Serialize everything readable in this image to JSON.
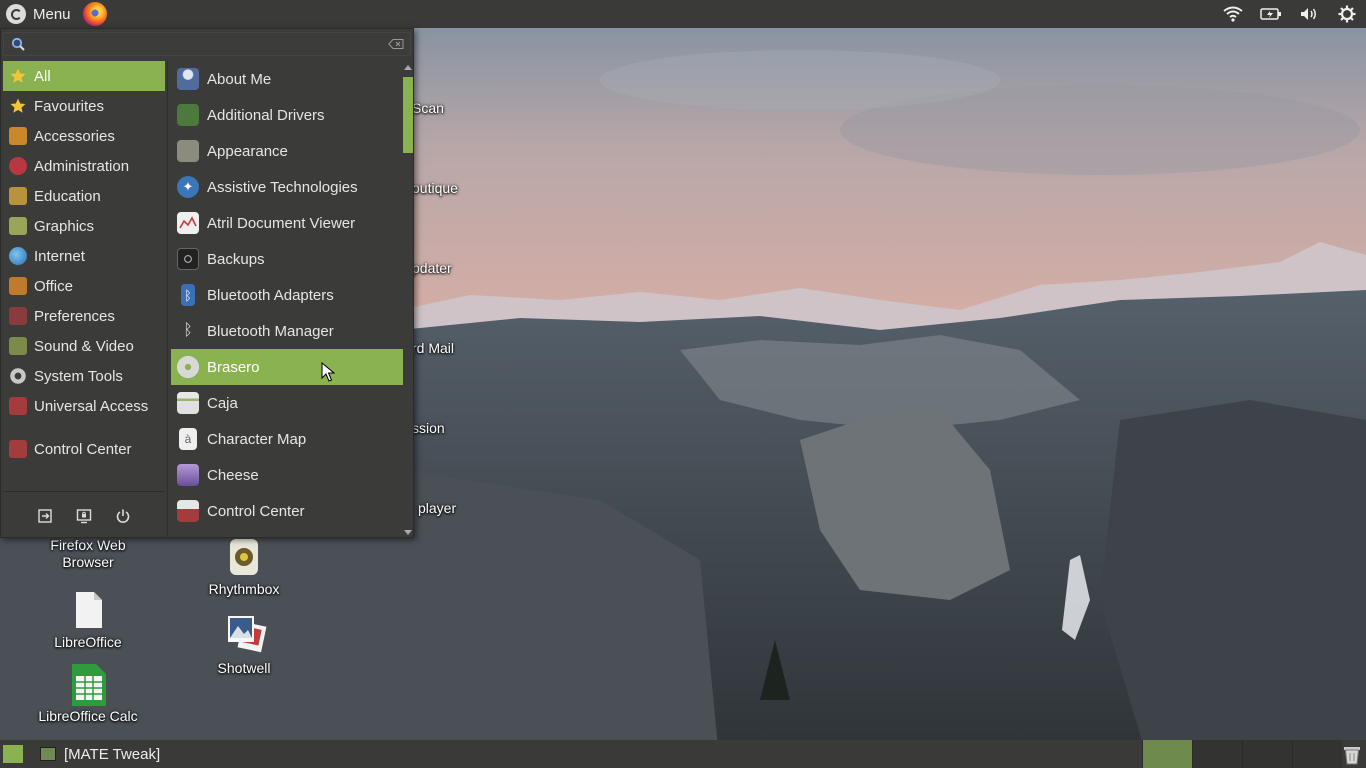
{
  "top_panel": {
    "menu_label": "Menu",
    "launcher_icon": "firefox-icon",
    "tray_icons": [
      "wifi-icon",
      "battery-icon",
      "volume-icon",
      "settings-gear-icon"
    ]
  },
  "menu": {
    "search": {
      "value": "",
      "placeholder": ""
    },
    "categories": [
      {
        "label": "All",
        "icon": "all-star-icon",
        "active": true
      },
      {
        "label": "Favourites",
        "icon": "favourites-star-icon"
      },
      {
        "label": "Accessories",
        "icon": "accessories-icon"
      },
      {
        "label": "Administration",
        "icon": "administration-icon"
      },
      {
        "label": "Education",
        "icon": "education-icon"
      },
      {
        "label": "Graphics",
        "icon": "graphics-icon"
      },
      {
        "label": "Internet",
        "icon": "internet-globe-icon"
      },
      {
        "label": "Office",
        "icon": "office-icon"
      },
      {
        "label": "Preferences",
        "icon": "preferences-icon"
      },
      {
        "label": "Sound & Video",
        "icon": "sound-video-icon"
      },
      {
        "label": "System Tools",
        "icon": "system-tools-gear-icon"
      },
      {
        "label": "Universal Access",
        "icon": "universal-access-icon"
      }
    ],
    "control_center_label": "Control Center",
    "bottom_buttons": [
      "logout-icon",
      "lock-screen-icon",
      "power-icon"
    ],
    "applications": [
      {
        "label": "About Me",
        "icon": "about-me-icon"
      },
      {
        "label": "Additional Drivers",
        "icon": "additional-drivers-icon"
      },
      {
        "label": "Appearance",
        "icon": "appearance-icon"
      },
      {
        "label": "Assistive Technologies",
        "icon": "assistive-technologies-icon"
      },
      {
        "label": "Atril Document Viewer",
        "icon": "atril-icon"
      },
      {
        "label": "Backups",
        "icon": "backups-icon"
      },
      {
        "label": "Bluetooth Adapters",
        "icon": "bluetooth-adapters-icon"
      },
      {
        "label": "Bluetooth Manager",
        "icon": "bluetooth-icon"
      },
      {
        "label": "Brasero",
        "icon": "brasero-disc-icon",
        "hovered": true
      },
      {
        "label": "Caja",
        "icon": "caja-icon"
      },
      {
        "label": "Character Map",
        "icon": "character-map-icon"
      },
      {
        "label": "Cheese",
        "icon": "cheese-icon"
      },
      {
        "label": "Control Center",
        "icon": "control-center-icon"
      }
    ]
  },
  "desktop": {
    "icons": [
      {
        "label": "Firefox Web Browser",
        "icon": "firefox-icon"
      },
      {
        "label": "Rhythmbox",
        "icon": "rhythmbox-icon"
      },
      {
        "label": "LibreOffice",
        "icon": "libreoffice-icon"
      },
      {
        "label": "Shotwell",
        "icon": "shotwell-icon"
      },
      {
        "label": "LibreOffice Calc",
        "icon": "libreoffice-calc-icon"
      }
    ],
    "partial_labels": [
      "Scan",
      "outique",
      "pdater",
      "rd Mail",
      "ssion",
      "player"
    ]
  },
  "bottom_panel": {
    "task_label": "[MATE Tweak]",
    "workspace_count": 4,
    "active_workspace": 1
  },
  "colors": {
    "accent": "#8ab251",
    "panel": "#3a3a38",
    "menu_bg": "#3b3b39"
  }
}
